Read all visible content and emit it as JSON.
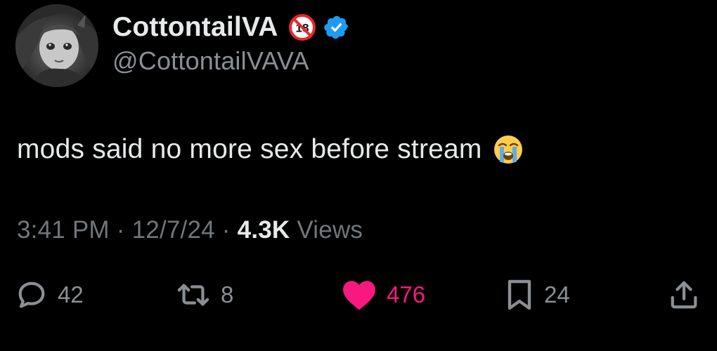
{
  "author": {
    "display_name": "CottontailVA",
    "handle": "@CottontailVAVA",
    "age_badge": "18",
    "verified": true,
    "avatar": "anime-character-avatar"
  },
  "tweet": {
    "text": "mods said no more sex before stream",
    "emoji": "loudly-crying-face"
  },
  "meta": {
    "time": "3:41 PM",
    "separator": "·",
    "date": "12/7/24",
    "views_count": "4.3K",
    "views_label": "Views"
  },
  "actions": {
    "replies": "42",
    "reposts": "8",
    "likes": "476",
    "bookmarks": "24"
  },
  "colors": {
    "background": "#000000",
    "text": "#e7e9ea",
    "muted": "#71767b",
    "verified": "#1d9bf0",
    "like": "#f91880"
  },
  "icons": [
    "reply-icon",
    "repost-icon",
    "like-icon",
    "bookmark-icon",
    "share-icon",
    "verified-icon",
    "age-restricted-icon"
  ]
}
